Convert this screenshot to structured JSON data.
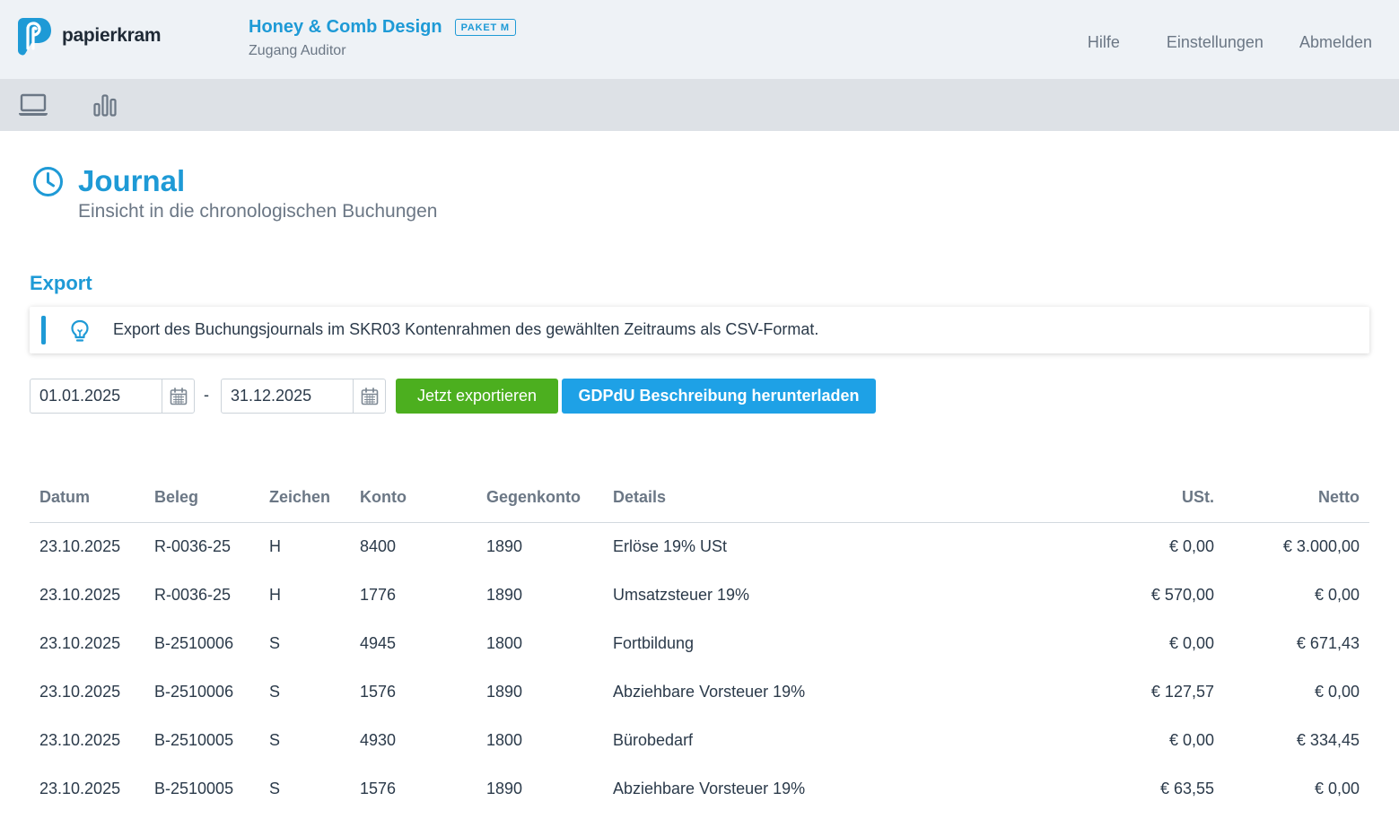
{
  "brand": {
    "name": "papierkram"
  },
  "company": {
    "name": "Honey & Comb Design",
    "badge": "PAKET M",
    "access": "Zugang Auditor"
  },
  "topnav": {
    "help": "Hilfe",
    "settings": "Einstellungen",
    "logout": "Abmelden"
  },
  "toolbar": {
    "icons": [
      "laptop-icon",
      "bar-chart-icon"
    ]
  },
  "page": {
    "title": "Journal",
    "subtitle": "Einsicht in die chronologischen Buchungen",
    "icon": "clock-icon"
  },
  "export": {
    "title": "Export",
    "hint": "Export des Buchungsjournals im SKR03 Kontenrahmen des gewählten Zeitraums als CSV-Format.",
    "date_from": "01.01.2025",
    "date_separator": "-",
    "date_to": "31.12.2025",
    "export_button": "Jetzt exportieren",
    "gdpdu_button": "GDPdU Beschreibung herunterladen"
  },
  "table": {
    "headers": [
      "Datum",
      "Beleg",
      "Zeichen",
      "Konto",
      "Gegenkonto",
      "Details",
      "USt.",
      "Netto"
    ],
    "rows": [
      [
        "23.10.2025",
        "R-0036-25",
        "H",
        "8400",
        "1890",
        "Erlöse 19% USt",
        "€ 0,00",
        "€ 3.000,00"
      ],
      [
        "23.10.2025",
        "R-0036-25",
        "H",
        "1776",
        "1890",
        "Umsatzsteuer 19%",
        "€ 570,00",
        "€ 0,00"
      ],
      [
        "23.10.2025",
        "B-2510006",
        "S",
        "4945",
        "1800",
        "Fortbildung",
        "€ 0,00",
        "€ 671,43"
      ],
      [
        "23.10.2025",
        "B-2510006",
        "S",
        "1576",
        "1890",
        "Abziehbare Vorsteuer 19%",
        "€ 127,57",
        "€ 0,00"
      ],
      [
        "23.10.2025",
        "B-2510005",
        "S",
        "4930",
        "1800",
        "Bürobedarf",
        "€ 0,00",
        "€ 334,45"
      ],
      [
        "23.10.2025",
        "B-2510005",
        "S",
        "1576",
        "1890",
        "Abziehbare Vorsteuer 19%",
        "€ 63,55",
        "€ 0,00"
      ]
    ]
  },
  "colors": {
    "accent": "#1e9ad6",
    "export_button": "#4caf1f",
    "gdpdu_button": "#1ea1e6",
    "topbar": "#eef2f6",
    "toolbar": "#dde1e6"
  }
}
